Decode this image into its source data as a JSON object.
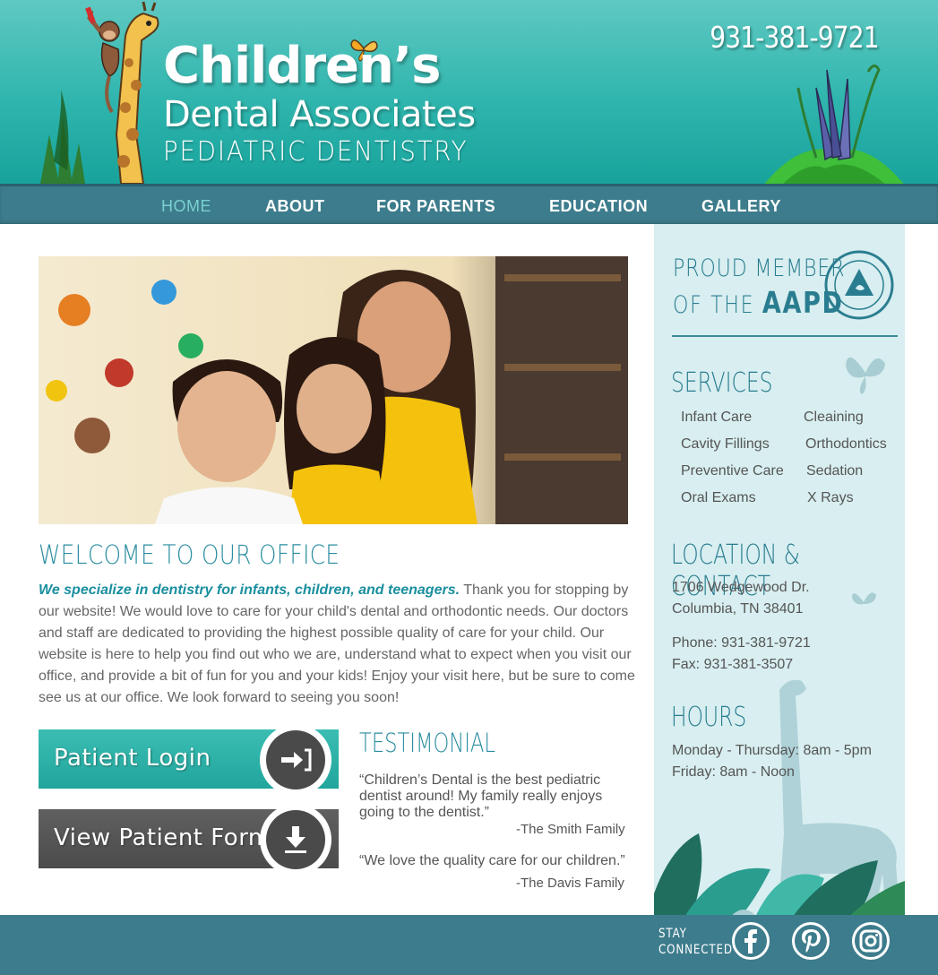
{
  "header": {
    "logo_line1": "Children’s",
    "logo_line2": "Dental Associates",
    "logo_line3": "PEDIATRIC DENTISTRY",
    "phone": "931-381-9721"
  },
  "nav": {
    "items": [
      {
        "label": "HOME",
        "active": true
      },
      {
        "label": "ABOUT"
      },
      {
        "label": "FOR PARENTS"
      },
      {
        "label": "EDUCATION"
      },
      {
        "label": "GALLERY"
      }
    ]
  },
  "welcome": {
    "title": "WELCOME TO OUR OFFICE",
    "highlight": "We specialize in dentistry for infants, children, and teenagers.",
    "body": " Thank you for stopping by our website! We would love to care for your child's dental and orthodontic needs. Our doctors and staff are dedicated to providing the highest possible quality of care for your child. Our website is here to help you find out who we are, understand what to expect when you visit our office, and provide a bit of fun for you and your kids! Enjoy your visit here, but be sure to come see us at our office. We look forward to seeing you soon!"
  },
  "buttons": {
    "login_label": "Patient Login",
    "form_label": "View Patient Form"
  },
  "testimonial": {
    "title": "TESTIMONIAL",
    "quotes": [
      {
        "text": "“Children’s Dental is the best pediatric dentist around! My family really enjoys going to the dentist.”",
        "author": "-The Smith Family"
      },
      {
        "text": "“We love the quality care for our children.”",
        "author": "-The Davis Family"
      }
    ]
  },
  "sidebar": {
    "aapd_proud": "PROUD MEMBER",
    "aapd_of": "OF THE",
    "aapd_acronym": "AAPD",
    "services_title": "SERVICES",
    "services_left": [
      "Infant Care",
      "Cavity Fillings",
      "Preventive Care",
      "Oral Exams"
    ],
    "services_right": [
      "Cleaining",
      "Orthodontics",
      "Sedation",
      "X Rays"
    ],
    "contact_title": "LOCATION & CONTACT",
    "address1": "1706 Wedgewood Dr.",
    "address2": "Columbia, TN 38401",
    "phone": "Phone: 931-381-9721",
    "fax": "Fax: 931-381-3507",
    "hours_title": "HOURS",
    "hours1": "Monday - Thursday: 8am - 5pm",
    "hours2": "Friday: 8am - Noon"
  },
  "footer": {
    "stay_line1": "STAY",
    "stay_line2": "CONNECTED",
    "social": [
      "facebook-icon",
      "pinterest-icon",
      "instagram-icon"
    ]
  },
  "colors": {
    "teal_header": "#2fb5ad",
    "nav_bg": "#3d7c8c",
    "accent": "#2a8da0",
    "sidebar_bg": "#d8eef0",
    "login_btn": "#21a59c",
    "form_btn": "#4b4b4b"
  }
}
